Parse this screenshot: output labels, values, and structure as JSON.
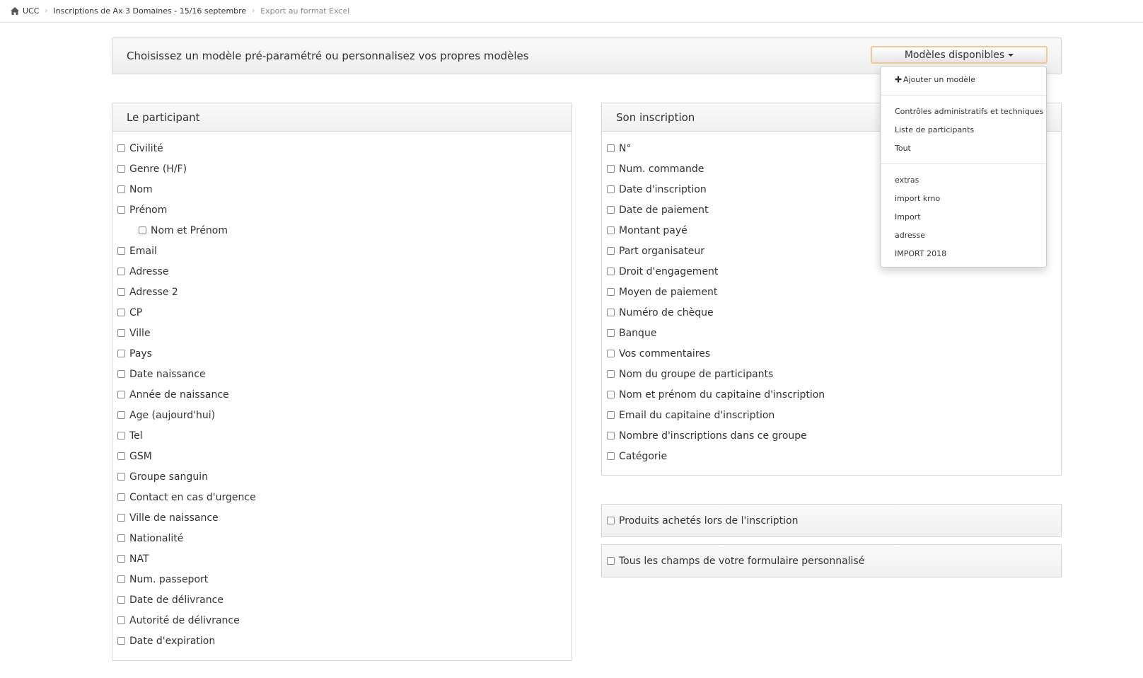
{
  "breadcrumb": {
    "items": [
      {
        "label": "UCC"
      },
      {
        "label": "Inscriptions de Ax 3 Domaines - 15/16 septembre"
      },
      {
        "label": "Export au format Excel"
      }
    ]
  },
  "header": {
    "title": "Choisissez un modèle pré-paramétré ou personnalisez vos propres modèles",
    "models_button": "Modèles disponibles"
  },
  "dropdown": {
    "add_label": "Ajouter un modèle",
    "presets": [
      "Contrôles administratifs et techniques",
      "Liste de participants",
      "Tout"
    ],
    "custom": [
      "extras",
      "import krno",
      "Import",
      "adresse",
      "IMPORT 2018"
    ]
  },
  "participant": {
    "title": "Le participant",
    "fields": [
      "Civilité",
      "Genre (H/F)",
      "Nom",
      "Prénom",
      "Nom et Prénom",
      "Email",
      "Adresse",
      "Adresse 2",
      "CP",
      "Ville",
      "Pays",
      "Date naissance",
      "Année de naissance",
      "Age (aujourd'hui)",
      "Tel",
      "GSM",
      "Groupe sanguin",
      "Contact en cas d'urgence",
      "Ville de naissance",
      "Nationalité",
      "NAT",
      "Num. passeport",
      "Date de délivrance",
      "Autorité de délivrance",
      "Date d'expiration"
    ]
  },
  "inscription": {
    "title": "Son inscription",
    "fields": [
      "N°",
      "Num. commande",
      "Date d'inscription",
      "Date de paiement",
      "Montant payé",
      "Part organisateur",
      "Droit d'engagement",
      "Moyen de paiement",
      "Numéro de chèque",
      "Banque",
      "Vos commentaires",
      "Nom du groupe de participants",
      "Nom et prénom du capitaine d'inscription",
      "Email du capitaine d'inscription",
      "Nombre d'inscriptions dans ce groupe",
      "Catégorie"
    ]
  },
  "extras": {
    "products_label": "Produits achetés lors de l'inscription",
    "custom_form_label": "Tous les champs de votre formulaire personnalisé"
  },
  "colors": {
    "accent_border": "#f0c89a",
    "panel_border": "#d6d6d6"
  }
}
